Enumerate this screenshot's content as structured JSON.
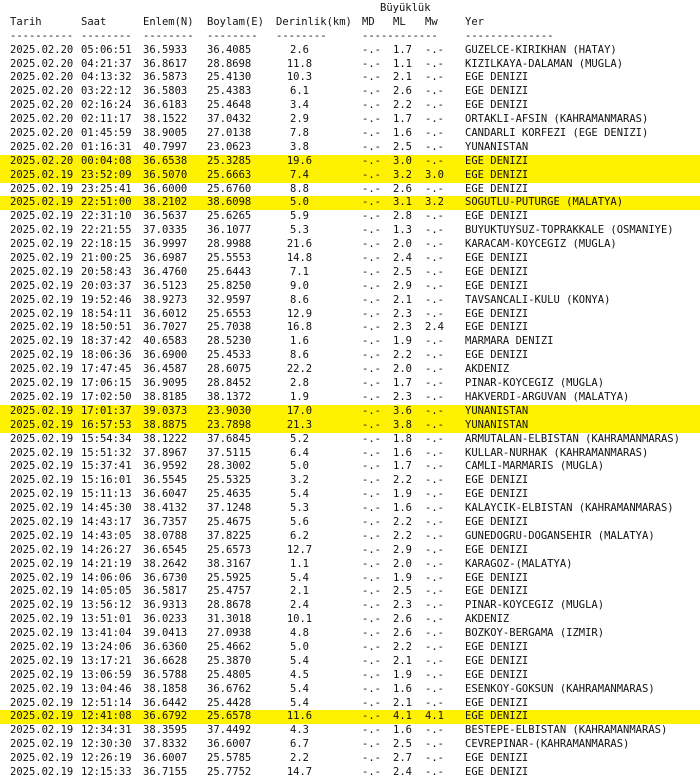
{
  "listing": {
    "group_header": "Büyüklük",
    "columns": {
      "date": "Tarih",
      "time": "Saat",
      "lat": "Enlem(N)",
      "lon": "Boylam(E)",
      "depth": "Derinlik(km)",
      "md": "MD",
      "ml": "ML",
      "mw": "Mw",
      "loc": "Yer"
    },
    "separators": {
      "date": "----------",
      "time": "--------",
      "lat": "--------",
      "lon": "--------",
      "depth": "--------",
      "mag": "------------",
      "loc": "--------------"
    },
    "rows": [
      {
        "date": "2025.02.20",
        "time": "05:06:51",
        "lat": "36.5933",
        "lon": "36.4085",
        "depth": "2.6",
        "md": "-.-",
        "ml": "1.7",
        "mw": "-.-",
        "loc": "GUZELCE-KIRIKHAN (HATAY)",
        "hl": false
      },
      {
        "date": "2025.02.20",
        "time": "04:21:37",
        "lat": "36.8617",
        "lon": "28.8698",
        "depth": "11.8",
        "md": "-.-",
        "ml": "1.1",
        "mw": "-.-",
        "loc": "KIZILKAYA-DALAMAN (MUGLA)",
        "hl": false
      },
      {
        "date": "2025.02.20",
        "time": "04:13:32",
        "lat": "36.5873",
        "lon": "25.4130",
        "depth": "10.3",
        "md": "-.-",
        "ml": "2.1",
        "mw": "-.-",
        "loc": "EGE DENIZI",
        "hl": false
      },
      {
        "date": "2025.02.20",
        "time": "03:22:12",
        "lat": "36.5803",
        "lon": "25.4383",
        "depth": "6.1",
        "md": "-.-",
        "ml": "2.6",
        "mw": "-.-",
        "loc": "EGE DENIZI",
        "hl": false
      },
      {
        "date": "2025.02.20",
        "time": "02:16:24",
        "lat": "36.6183",
        "lon": "25.4648",
        "depth": "3.4",
        "md": "-.-",
        "ml": "2.2",
        "mw": "-.-",
        "loc": "EGE DENIZI",
        "hl": false
      },
      {
        "date": "2025.02.20",
        "time": "02:11:17",
        "lat": "38.1522",
        "lon": "37.0432",
        "depth": "2.9",
        "md": "-.-",
        "ml": "1.7",
        "mw": "-.-",
        "loc": "ORTAKLI-AFSIN (KAHRAMANMARAS)",
        "hl": false
      },
      {
        "date": "2025.02.20",
        "time": "01:45:59",
        "lat": "38.9005",
        "lon": "27.0138",
        "depth": "7.8",
        "md": "-.-",
        "ml": "1.6",
        "mw": "-.-",
        "loc": "CANDARLI KORFEZI (EGE DENIZI)",
        "hl": false
      },
      {
        "date": "2025.02.20",
        "time": "01:16:31",
        "lat": "40.7997",
        "lon": "23.0623",
        "depth": "3.8",
        "md": "-.-",
        "ml": "2.5",
        "mw": "-.-",
        "loc": "YUNANISTAN",
        "hl": false
      },
      {
        "date": "2025.02.20",
        "time": "00:04:08",
        "lat": "36.6538",
        "lon": "25.3285",
        "depth": "19.6",
        "md": "-.-",
        "ml": "3.0",
        "mw": "-.-",
        "loc": "EGE DENIZI",
        "hl": true
      },
      {
        "date": "2025.02.19",
        "time": "23:52:09",
        "lat": "36.5070",
        "lon": "25.6663",
        "depth": "7.4",
        "md": "-.-",
        "ml": "3.2",
        "mw": "3.0",
        "loc": "EGE DENIZI",
        "hl": true
      },
      {
        "date": "2025.02.19",
        "time": "23:25:41",
        "lat": "36.6000",
        "lon": "25.6760",
        "depth": "8.8",
        "md": "-.-",
        "ml": "2.6",
        "mw": "-.-",
        "loc": "EGE DENIZI",
        "hl": false
      },
      {
        "date": "2025.02.19",
        "time": "22:51:00",
        "lat": "38.2102",
        "lon": "38.6098",
        "depth": "5.0",
        "md": "-.-",
        "ml": "3.1",
        "mw": "3.2",
        "loc": "SOGUTLU-PUTURGE (MALATYA)",
        "hl": true
      },
      {
        "date": "2025.02.19",
        "time": "22:31:10",
        "lat": "36.5637",
        "lon": "25.6265",
        "depth": "5.9",
        "md": "-.-",
        "ml": "2.8",
        "mw": "-.-",
        "loc": "EGE DENIZI",
        "hl": false
      },
      {
        "date": "2025.02.19",
        "time": "22:21:55",
        "lat": "37.0335",
        "lon": "36.1077",
        "depth": "5.3",
        "md": "-.-",
        "ml": "1.3",
        "mw": "-.-",
        "loc": "BUYUKTUYSUZ-TOPRAKKALE (OSMANIYE)",
        "hl": false
      },
      {
        "date": "2025.02.19",
        "time": "22:18:15",
        "lat": "36.9997",
        "lon": "28.9988",
        "depth": "21.6",
        "md": "-.-",
        "ml": "2.0",
        "mw": "-.-",
        "loc": "KARACAM-KOYCEGIZ (MUGLA)",
        "hl": false
      },
      {
        "date": "2025.02.19",
        "time": "21:00:25",
        "lat": "36.6987",
        "lon": "25.5553",
        "depth": "14.8",
        "md": "-.-",
        "ml": "2.4",
        "mw": "-.-",
        "loc": "EGE DENIZI",
        "hl": false
      },
      {
        "date": "2025.02.19",
        "time": "20:58:43",
        "lat": "36.4760",
        "lon": "25.6443",
        "depth": "7.1",
        "md": "-.-",
        "ml": "2.5",
        "mw": "-.-",
        "loc": "EGE DENIZI",
        "hl": false
      },
      {
        "date": "2025.02.19",
        "time": "20:03:37",
        "lat": "36.5123",
        "lon": "25.8250",
        "depth": "9.0",
        "md": "-.-",
        "ml": "2.9",
        "mw": "-.-",
        "loc": "EGE DENIZI",
        "hl": false
      },
      {
        "date": "2025.02.19",
        "time": "19:52:46",
        "lat": "38.9273",
        "lon": "32.9597",
        "depth": "8.6",
        "md": "-.-",
        "ml": "2.1",
        "mw": "-.-",
        "loc": "TAVSANCALI-KULU (KONYA)",
        "hl": false
      },
      {
        "date": "2025.02.19",
        "time": "18:54:11",
        "lat": "36.6012",
        "lon": "25.6553",
        "depth": "12.9",
        "md": "-.-",
        "ml": "2.3",
        "mw": "-.-",
        "loc": "EGE DENIZI",
        "hl": false
      },
      {
        "date": "2025.02.19",
        "time": "18:50:51",
        "lat": "36.7027",
        "lon": "25.7038",
        "depth": "16.8",
        "md": "-.-",
        "ml": "2.3",
        "mw": "2.4",
        "loc": "EGE DENIZI",
        "hl": false
      },
      {
        "date": "2025.02.19",
        "time": "18:37:42",
        "lat": "40.6583",
        "lon": "28.5230",
        "depth": "1.6",
        "md": "-.-",
        "ml": "1.9",
        "mw": "-.-",
        "loc": "MARMARA DENIZI",
        "hl": false
      },
      {
        "date": "2025.02.19",
        "time": "18:06:36",
        "lat": "36.6900",
        "lon": "25.4533",
        "depth": "8.6",
        "md": "-.-",
        "ml": "2.2",
        "mw": "-.-",
        "loc": "EGE DENIZI",
        "hl": false
      },
      {
        "date": "2025.02.19",
        "time": "17:47:45",
        "lat": "36.4587",
        "lon": "28.6075",
        "depth": "22.2",
        "md": "-.-",
        "ml": "2.0",
        "mw": "-.-",
        "loc": "AKDENIZ",
        "hl": false
      },
      {
        "date": "2025.02.19",
        "time": "17:06:15",
        "lat": "36.9095",
        "lon": "28.8452",
        "depth": "2.8",
        "md": "-.-",
        "ml": "1.7",
        "mw": "-.-",
        "loc": "PINAR-KOYCEGIZ (MUGLA)",
        "hl": false
      },
      {
        "date": "2025.02.19",
        "time": "17:02:50",
        "lat": "38.8185",
        "lon": "38.1372",
        "depth": "1.9",
        "md": "-.-",
        "ml": "2.3",
        "mw": "-.-",
        "loc": "HAKVERDI-ARGUVAN (MALATYA)",
        "hl": false
      },
      {
        "date": "2025.02.19",
        "time": "17:01:37",
        "lat": "39.0373",
        "lon": "23.9030",
        "depth": "17.0",
        "md": "-.-",
        "ml": "3.6",
        "mw": "-.-",
        "loc": "YUNANISTAN",
        "hl": true
      },
      {
        "date": "2025.02.19",
        "time": "16:57:53",
        "lat": "38.8875",
        "lon": "23.7898",
        "depth": "21.3",
        "md": "-.-",
        "ml": "3.8",
        "mw": "-.-",
        "loc": "YUNANISTAN",
        "hl": true
      },
      {
        "date": "2025.02.19",
        "time": "15:54:34",
        "lat": "38.1222",
        "lon": "37.6845",
        "depth": "5.2",
        "md": "-.-",
        "ml": "1.8",
        "mw": "-.-",
        "loc": "ARMUTALAN-ELBISTAN (KAHRAMANMARAS)",
        "hl": false
      },
      {
        "date": "2025.02.19",
        "time": "15:51:32",
        "lat": "37.8967",
        "lon": "37.5115",
        "depth": "6.4",
        "md": "-.-",
        "ml": "1.6",
        "mw": "-.-",
        "loc": "KULLAR-NURHAK (KAHRAMANMARAS)",
        "hl": false
      },
      {
        "date": "2025.02.19",
        "time": "15:37:41",
        "lat": "36.9592",
        "lon": "28.3002",
        "depth": "5.0",
        "md": "-.-",
        "ml": "1.7",
        "mw": "-.-",
        "loc": "CAMLI-MARMARIS (MUGLA)",
        "hl": false
      },
      {
        "date": "2025.02.19",
        "time": "15:16:01",
        "lat": "36.5545",
        "lon": "25.5325",
        "depth": "3.2",
        "md": "-.-",
        "ml": "2.2",
        "mw": "-.-",
        "loc": "EGE DENIZI",
        "hl": false
      },
      {
        "date": "2025.02.19",
        "time": "15:11:13",
        "lat": "36.6047",
        "lon": "25.4635",
        "depth": "5.4",
        "md": "-.-",
        "ml": "1.9",
        "mw": "-.-",
        "loc": "EGE DENIZI",
        "hl": false
      },
      {
        "date": "2025.02.19",
        "time": "14:45:30",
        "lat": "38.4132",
        "lon": "37.1248",
        "depth": "5.3",
        "md": "-.-",
        "ml": "1.6",
        "mw": "-.-",
        "loc": "KALAYCIK-ELBISTAN (KAHRAMANMARAS)",
        "hl": false
      },
      {
        "date": "2025.02.19",
        "time": "14:43:17",
        "lat": "36.7357",
        "lon": "25.4675",
        "depth": "5.6",
        "md": "-.-",
        "ml": "2.2",
        "mw": "-.-",
        "loc": "EGE DENIZI",
        "hl": false
      },
      {
        "date": "2025.02.19",
        "time": "14:43:05",
        "lat": "38.0788",
        "lon": "37.8225",
        "depth": "6.2",
        "md": "-.-",
        "ml": "2.2",
        "mw": "-.-",
        "loc": "GUNEDOGRU-DOGANSEHIR (MALATYA)",
        "hl": false
      },
      {
        "date": "2025.02.19",
        "time": "14:26:27",
        "lat": "36.6545",
        "lon": "25.6573",
        "depth": "12.7",
        "md": "-.-",
        "ml": "2.9",
        "mw": "-.-",
        "loc": "EGE DENIZI",
        "hl": false
      },
      {
        "date": "2025.02.19",
        "time": "14:21:19",
        "lat": "38.2642",
        "lon": "38.3167",
        "depth": "1.1",
        "md": "-.-",
        "ml": "2.0",
        "mw": "-.-",
        "loc": "KARAGOZ-(MALATYA)",
        "hl": false
      },
      {
        "date": "2025.02.19",
        "time": "14:06:06",
        "lat": "36.6730",
        "lon": "25.5925",
        "depth": "5.4",
        "md": "-.-",
        "ml": "1.9",
        "mw": "-.-",
        "loc": "EGE DENIZI",
        "hl": false
      },
      {
        "date": "2025.02.19",
        "time": "14:05:05",
        "lat": "36.5817",
        "lon": "25.4757",
        "depth": "2.1",
        "md": "-.-",
        "ml": "2.5",
        "mw": "-.-",
        "loc": "EGE DENIZI",
        "hl": false
      },
      {
        "date": "2025.02.19",
        "time": "13:56:12",
        "lat": "36.9313",
        "lon": "28.8678",
        "depth": "2.4",
        "md": "-.-",
        "ml": "2.3",
        "mw": "-.-",
        "loc": "PINAR-KOYCEGIZ (MUGLA)",
        "hl": false
      },
      {
        "date": "2025.02.19",
        "time": "13:51:01",
        "lat": "36.0233",
        "lon": "31.3018",
        "depth": "10.1",
        "md": "-.-",
        "ml": "2.6",
        "mw": "-.-",
        "loc": "AKDENIZ",
        "hl": false
      },
      {
        "date": "2025.02.19",
        "time": "13:41:04",
        "lat": "39.0413",
        "lon": "27.0938",
        "depth": "4.8",
        "md": "-.-",
        "ml": "2.6",
        "mw": "-.-",
        "loc": "BOZKOY-BERGAMA (IZMIR)",
        "hl": false
      },
      {
        "date": "2025.02.19",
        "time": "13:24:06",
        "lat": "36.6360",
        "lon": "25.4662",
        "depth": "5.0",
        "md": "-.-",
        "ml": "2.2",
        "mw": "-.-",
        "loc": "EGE DENIZI",
        "hl": false
      },
      {
        "date": "2025.02.19",
        "time": "13:17:21",
        "lat": "36.6628",
        "lon": "25.3870",
        "depth": "5.4",
        "md": "-.-",
        "ml": "2.1",
        "mw": "-.-",
        "loc": "EGE DENIZI",
        "hl": false
      },
      {
        "date": "2025.02.19",
        "time": "13:06:59",
        "lat": "36.5788",
        "lon": "25.4805",
        "depth": "4.5",
        "md": "-.-",
        "ml": "1.9",
        "mw": "-.-",
        "loc": "EGE DENIZI",
        "hl": false
      },
      {
        "date": "2025.02.19",
        "time": "13:04:46",
        "lat": "38.1858",
        "lon": "36.6762",
        "depth": "5.4",
        "md": "-.-",
        "ml": "1.6",
        "mw": "-.-",
        "loc": "ESENKOY-GOKSUN (KAHRAMANMARAS)",
        "hl": false
      },
      {
        "date": "2025.02.19",
        "time": "12:51:14",
        "lat": "36.6442",
        "lon": "25.4428",
        "depth": "5.4",
        "md": "-.-",
        "ml": "2.1",
        "mw": "-.-",
        "loc": "EGE DENIZI",
        "hl": false
      },
      {
        "date": "2025.02.19",
        "time": "12:41:08",
        "lat": "36.6792",
        "lon": "25.6578",
        "depth": "11.6",
        "md": "-.-",
        "ml": "4.1",
        "mw": "4.1",
        "loc": "EGE DENIZI",
        "hl": true
      },
      {
        "date": "2025.02.19",
        "time": "12:34:31",
        "lat": "38.3595",
        "lon": "37.4492",
        "depth": "4.3",
        "md": "-.-",
        "ml": "1.6",
        "mw": "-.-",
        "loc": "BESTEPE-ELBISTAN (KAHRAMANMARAS)",
        "hl": false
      },
      {
        "date": "2025.02.19",
        "time": "12:30:30",
        "lat": "37.8332",
        "lon": "36.6007",
        "depth": "6.7",
        "md": "-.-",
        "ml": "2.5",
        "mw": "-.-",
        "loc": "CEVREPINAR-(KAHRAMANMARAS)",
        "hl": false
      },
      {
        "date": "2025.02.19",
        "time": "12:26:19",
        "lat": "36.6007",
        "lon": "25.5785",
        "depth": "2.2",
        "md": "-.-",
        "ml": "2.7",
        "mw": "-.-",
        "loc": "EGE DENIZI",
        "hl": false
      },
      {
        "date": "2025.02.19",
        "time": "12:15:33",
        "lat": "36.7155",
        "lon": "25.7752",
        "depth": "14.7",
        "md": "-.-",
        "ml": "2.4",
        "mw": "-.-",
        "loc": "EGE DENIZI",
        "hl": false
      }
    ]
  }
}
